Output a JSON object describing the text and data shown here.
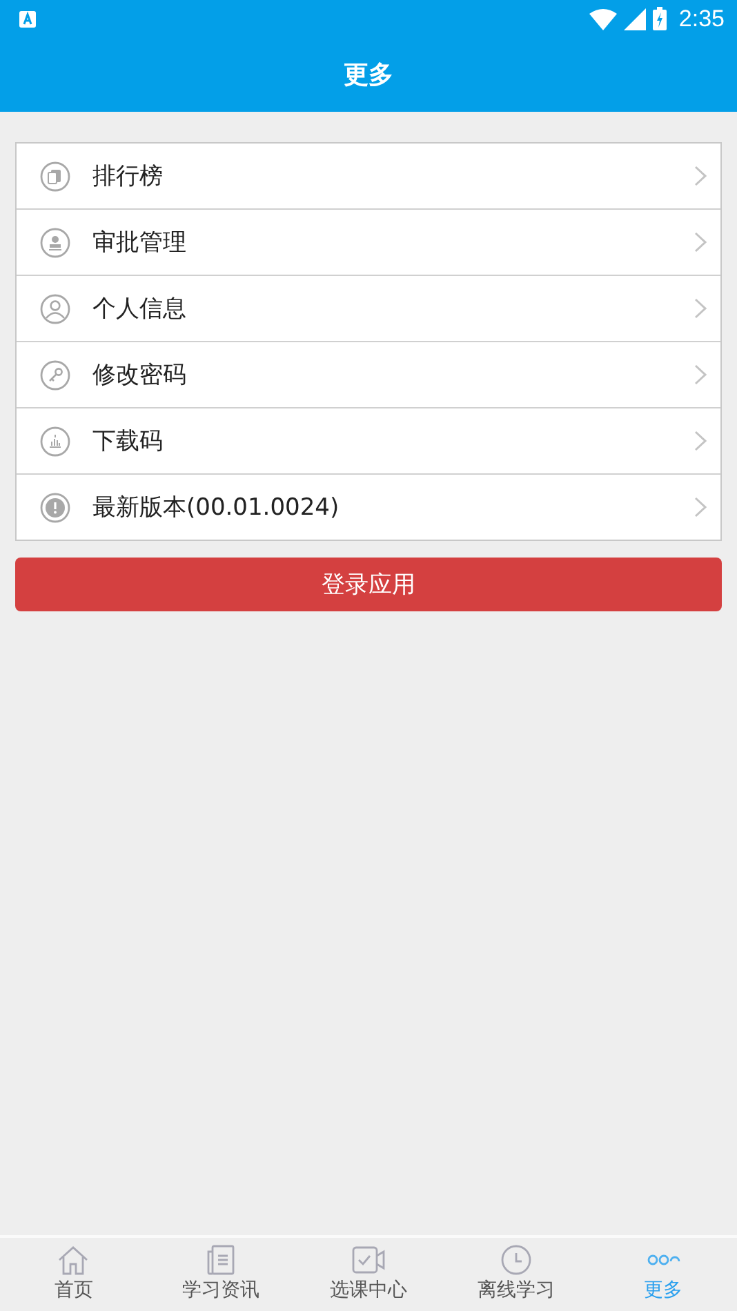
{
  "status_bar": {
    "time": "2:35"
  },
  "header": {
    "title": "更多"
  },
  "menu": [
    {
      "label": "排行榜"
    },
    {
      "label": "审批管理"
    },
    {
      "label": "个人信息"
    },
    {
      "label": "修改密码"
    },
    {
      "label": "下载码"
    },
    {
      "label": "最新版本(00.01.0024)"
    }
  ],
  "login_button": "登录应用",
  "tabs": [
    {
      "label": "首页",
      "selected": false
    },
    {
      "label": "学习资讯",
      "selected": false
    },
    {
      "label": "选课中心",
      "selected": false
    },
    {
      "label": "离线学习",
      "selected": false
    },
    {
      "label": "更多",
      "selected": true
    }
  ]
}
